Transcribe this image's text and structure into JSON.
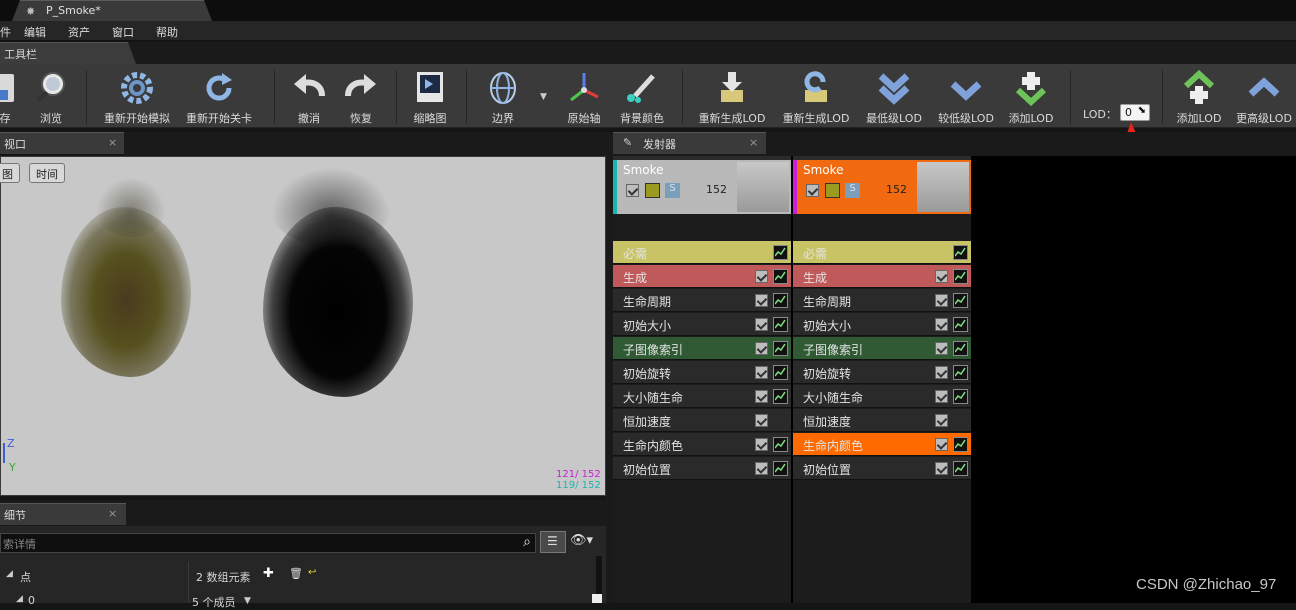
{
  "document_tab": {
    "title": "P_Smoke*",
    "close": "×"
  },
  "menu": [
    "件",
    "编辑",
    "资产",
    "窗口",
    "帮助"
  ],
  "toolbar_tab": {
    "title": "工具栏"
  },
  "toolbar": {
    "save": "存",
    "browse": "浏览",
    "restart_sim": "重新开始模拟",
    "restart_level": "重新开始关卡",
    "undo": "撤消",
    "redo": "恢复",
    "thumbnail": "缩略图",
    "bounds": "边界",
    "origin_axis": "原始轴",
    "bg_color": "背景颜色",
    "regen_lod1": "重新生成LOD",
    "regen_lod2": "重新生成LOD",
    "lowest_lod": "最低级LOD",
    "lower_lod": "较低级LOD",
    "add_lod1": "添加LOD",
    "lod_label": "LOD：",
    "lod_value": "0",
    "add_lod2": "添加LOD",
    "higher_lod": "更高级LOD"
  },
  "viewport": {
    "tab": "视口",
    "btn_view": "图",
    "btn_time": "时间",
    "axis_z": "Z",
    "axis_y": "Y",
    "stat1": "121/ 152",
    "stat2": "119/ 152"
  },
  "details": {
    "tab": "细节",
    "search_placeholder": "索详情",
    "row1_label": "点",
    "row1_value": "2 数组元素",
    "row2_label": "0",
    "row2_value": "5 个成员"
  },
  "emitter": {
    "tab": "发射器",
    "columns": [
      {
        "name": "Smoke",
        "count": "152",
        "s": "S",
        "accent": "#19b5b5",
        "head_bg": "#b9b9b9"
      },
      {
        "name": "Smoke",
        "count": "152",
        "s": "S",
        "accent": "#c820d8",
        "head_bg": "#f26a10"
      }
    ],
    "modules": [
      "必需",
      "生成",
      "生命周期",
      "初始大小",
      "子图像索引",
      "初始旋转",
      "大小随生命",
      "恒加速度",
      "生命内颜色",
      "初始位置"
    ]
  },
  "watermark": "CSDN @Zhichao_97",
  "colors": {
    "required": "#c8c364",
    "spawn": "#c05a5a",
    "subuv": "#2f5a33",
    "selected": "#ff6a00",
    "arrow": "#e8231e"
  }
}
